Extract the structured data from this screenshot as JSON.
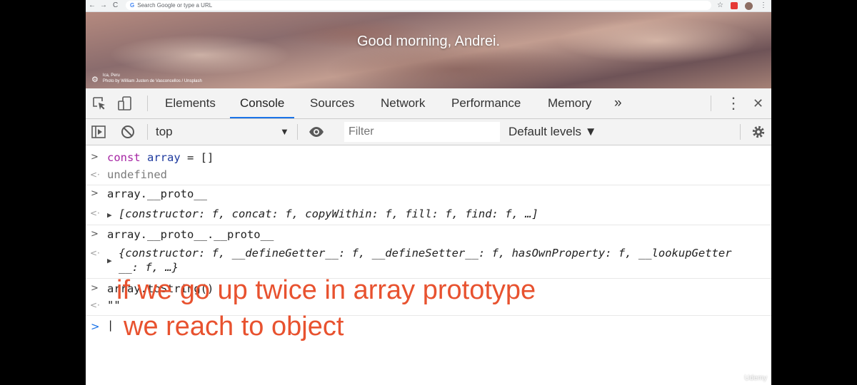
{
  "browser": {
    "nav_back": "←",
    "nav_forward": "→",
    "nav_reload": "C",
    "omnibox_g": "G",
    "omnibox_placeholder": "Search Google or type a URL",
    "star": "☆"
  },
  "newtab": {
    "greeting": "Good morning, Andrei.",
    "location": "Ica, Peru",
    "photo_credit": "Photo by William Justen de Vasconcellos / Unsplash"
  },
  "devtools": {
    "tabs": [
      "Elements",
      "Console",
      "Sources",
      "Network",
      "Performance",
      "Memory"
    ],
    "active_tab": "Console",
    "more_tabs": "»",
    "kebab": "⋮",
    "close": "✕",
    "context": "top",
    "context_arrow": "▼",
    "filter_placeholder": "Filter",
    "levels": "Default levels ▼"
  },
  "console": {
    "prompt_symbol": ">",
    "return_symbol": "<·",
    "lines": [
      {
        "input_kw": "const",
        "input_var": "array",
        "input_rest": " = []",
        "output": "undefined"
      },
      {
        "input": "array.__proto__",
        "output": "[constructor: f, concat: f, copyWithin: f, fill: f, find: f, …]"
      },
      {
        "input": "array.__proto__.__proto__",
        "output_line1": "{constructor: f, __defineGetter__: f, __defineSetter__: f, hasOwnProperty: f, __lookupGetter",
        "output_line2": "__: f, …}"
      },
      {
        "input": "array.toString()",
        "output": "\"\""
      }
    ],
    "cursor": "|"
  },
  "annotation": {
    "line1": "if we go up twice in array prototype",
    "line2": "we reach to object"
  },
  "watermark": "Udemy"
}
